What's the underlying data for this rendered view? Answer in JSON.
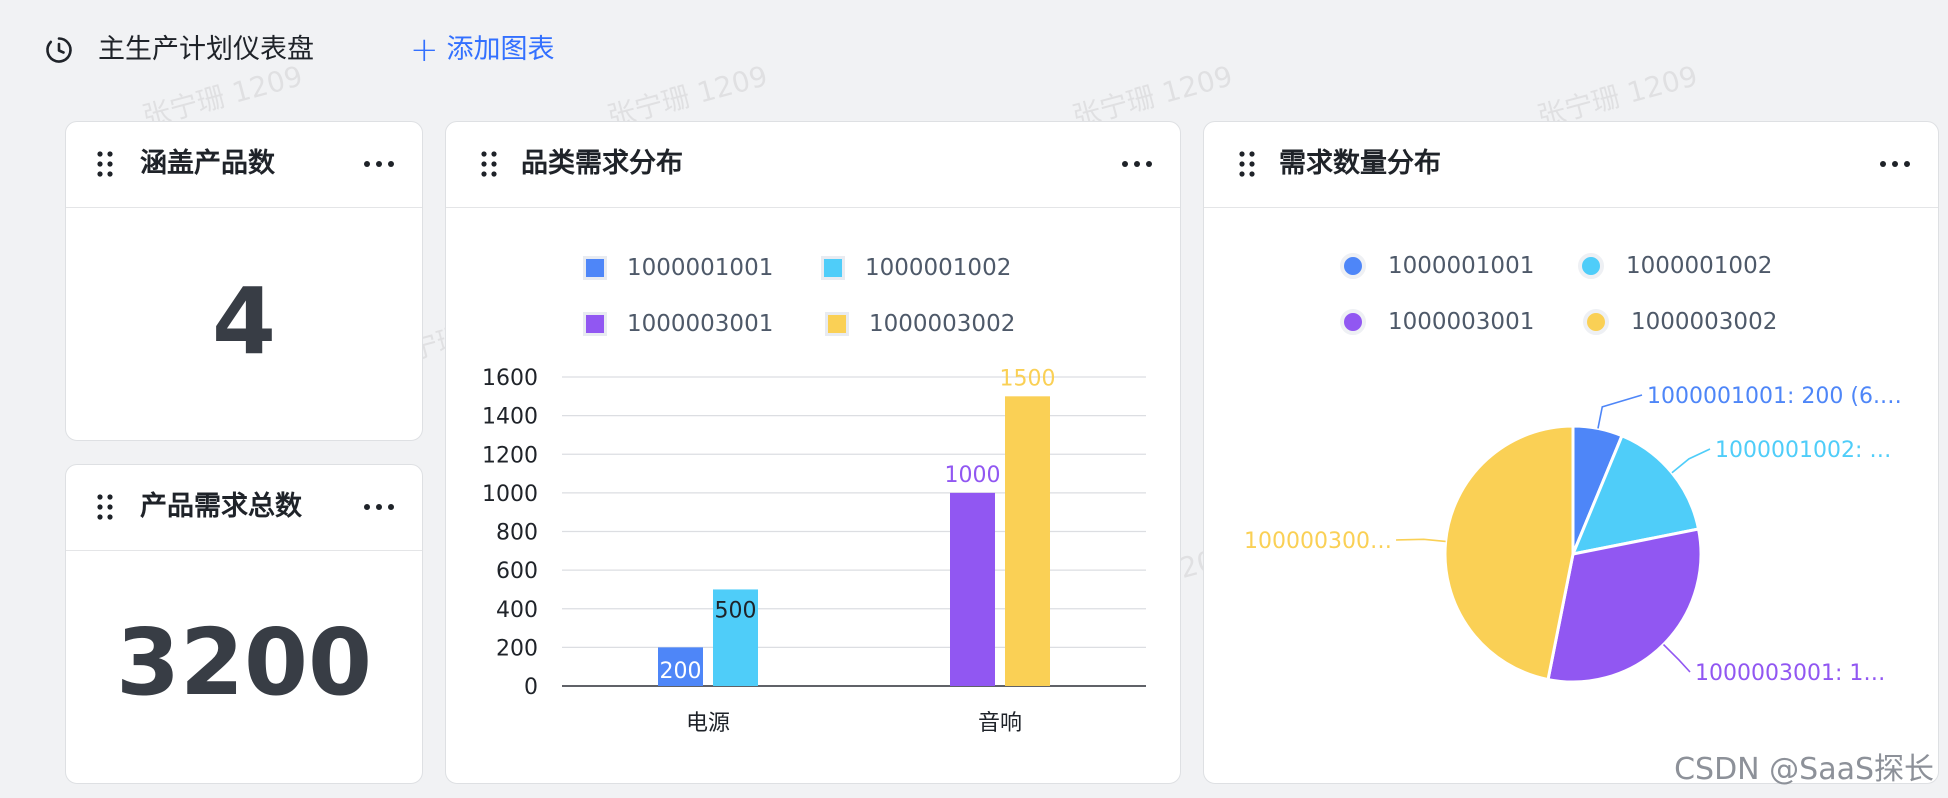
{
  "header": {
    "dashboard_title": "主生产计划仪表盘",
    "add_chart_plus": "+",
    "add_chart_label": "添加图表"
  },
  "watermark": "张宁珊 1209",
  "footer_mark": "CSDN @SaaS探长",
  "cards": {
    "product_count": {
      "title": "涵盖产品数",
      "value": "4"
    },
    "demand_total": {
      "title": "产品需求总数",
      "value": "3200"
    },
    "category_chart": {
      "title": "品类需求分布"
    },
    "quantity_chart": {
      "title": "需求数量分布"
    }
  },
  "colors": {
    "accent": "#3370ff",
    "s1": "#4e86f8",
    "s2": "#4fcdf9",
    "s3": "#9157f2",
    "s4": "#fad055"
  },
  "chart_data": [
    {
      "type": "bar",
      "title": "品类需求分布",
      "categories": [
        "电源",
        "音响"
      ],
      "series": [
        {
          "name": "1000001001",
          "values": [
            200,
            null
          ]
        },
        {
          "name": "1000001002",
          "values": [
            500,
            null
          ]
        },
        {
          "name": "1000003001",
          "values": [
            null,
            1000
          ]
        },
        {
          "name": "1000003002",
          "values": [
            null,
            1500
          ]
        }
      ],
      "yticks": [
        "0",
        "200",
        "400",
        "600",
        "800",
        "1000",
        "1200",
        "1400",
        "1600"
      ],
      "ylim": [
        0,
        1600
      ],
      "grid": true,
      "legend": "top"
    },
    {
      "type": "pie",
      "title": "需求数量分布",
      "labels": [
        "1000001001",
        "1000001002",
        "1000003001",
        "1000003002"
      ],
      "values": [
        200,
        500,
        1000,
        1500
      ],
      "slice_labels": [
        "1000001001: 200 (6.…",
        "1000001002: …",
        "1000003001: 1…",
        "100000300…"
      ],
      "legend": "top"
    }
  ]
}
